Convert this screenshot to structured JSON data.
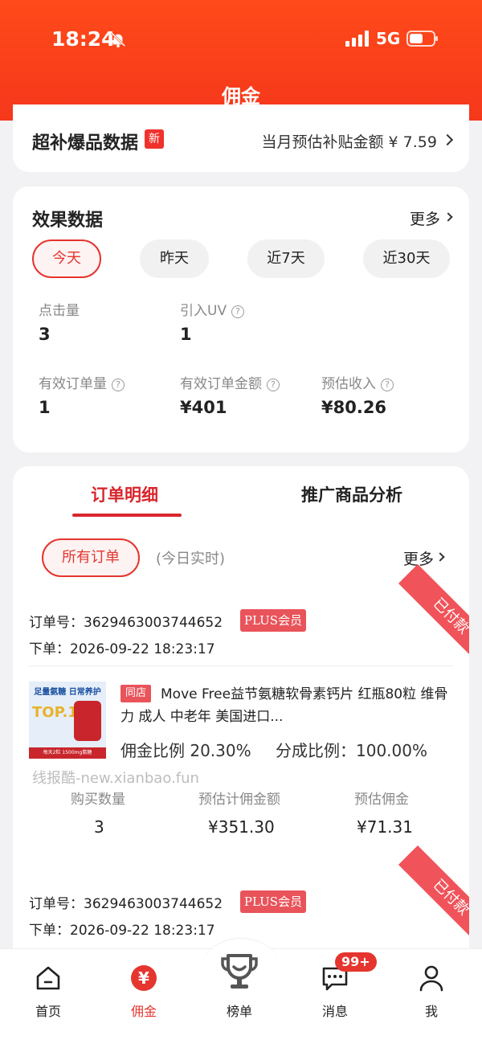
{
  "status_bar": {
    "time": "18:24",
    "network": "5G"
  },
  "nav": {
    "title": "佣金"
  },
  "subsidy": {
    "title": "超补爆品数据",
    "badge": "新",
    "right_text": "当月预估补贴金额 ¥ 7.59"
  },
  "effect": {
    "title": "效果数据",
    "more": "更多",
    "periods": [
      "今天",
      "昨天",
      "近7天",
      "近30天"
    ],
    "active_period": "今天",
    "stats": {
      "clicks": {
        "label": "点击量",
        "value": "3"
      },
      "uv": {
        "label": "引入UV",
        "value": "1"
      },
      "valid_orders": {
        "label": "有效订单量",
        "value": "1"
      },
      "valid_amount": {
        "label": "有效订单金额",
        "value": "¥401"
      },
      "est_income": {
        "label": "预估收入",
        "value": "¥80.26"
      }
    }
  },
  "orders": {
    "tabs": [
      "订单明细",
      "推广商品分析"
    ],
    "active_tab": "订单明细",
    "filter": "所有订单",
    "filter_note": "(今日实时)",
    "more": "更多",
    "watermark": "线报酷-new.xianbao.fun",
    "columns": [
      "购买数量",
      "预估计佣金额",
      "预估佣金"
    ],
    "items": [
      {
        "order_no": "订单号：3629463003744652",
        "member_badge": "PLUS会员",
        "order_time": "下单：2026-09-22 18:23:17",
        "status": "已付款",
        "store_tag": "同店",
        "product_title": "Move Free益节氨糖软骨素钙片 红瓶80粒 维骨力 成人 中老年 美国进口...",
        "commission_ratio": "佣金比例 20.30%",
        "share_ratio": "分成比例：100.00%",
        "quantity": "3",
        "commission_base": "¥351.30",
        "est_commission": "¥71.31",
        "image_text": {
          "line1": "足量氨糖 日常养护",
          "line2": "TOP.1",
          "line3": "每天2粒 1500mg氨糖"
        }
      },
      {
        "order_no": "订单号：3629463003744652",
        "member_badge": "PLUS会员",
        "order_time": "下单：2026-09-22 18:23:17",
        "status": "已付款"
      }
    ]
  },
  "tabbar": {
    "items": [
      {
        "label": "首页",
        "icon": "home-icon"
      },
      {
        "label": "佣金",
        "icon": "yen-icon"
      },
      {
        "label": "榜单",
        "icon": "trophy-icon"
      },
      {
        "label": "消息",
        "icon": "message-icon"
      },
      {
        "label": "我",
        "icon": "user-icon"
      }
    ],
    "active": "佣金",
    "message_badge": "99+"
  },
  "colors": {
    "brand": "#f5371b",
    "accent_red": "#e5352f",
    "badge": "#e9535a"
  }
}
